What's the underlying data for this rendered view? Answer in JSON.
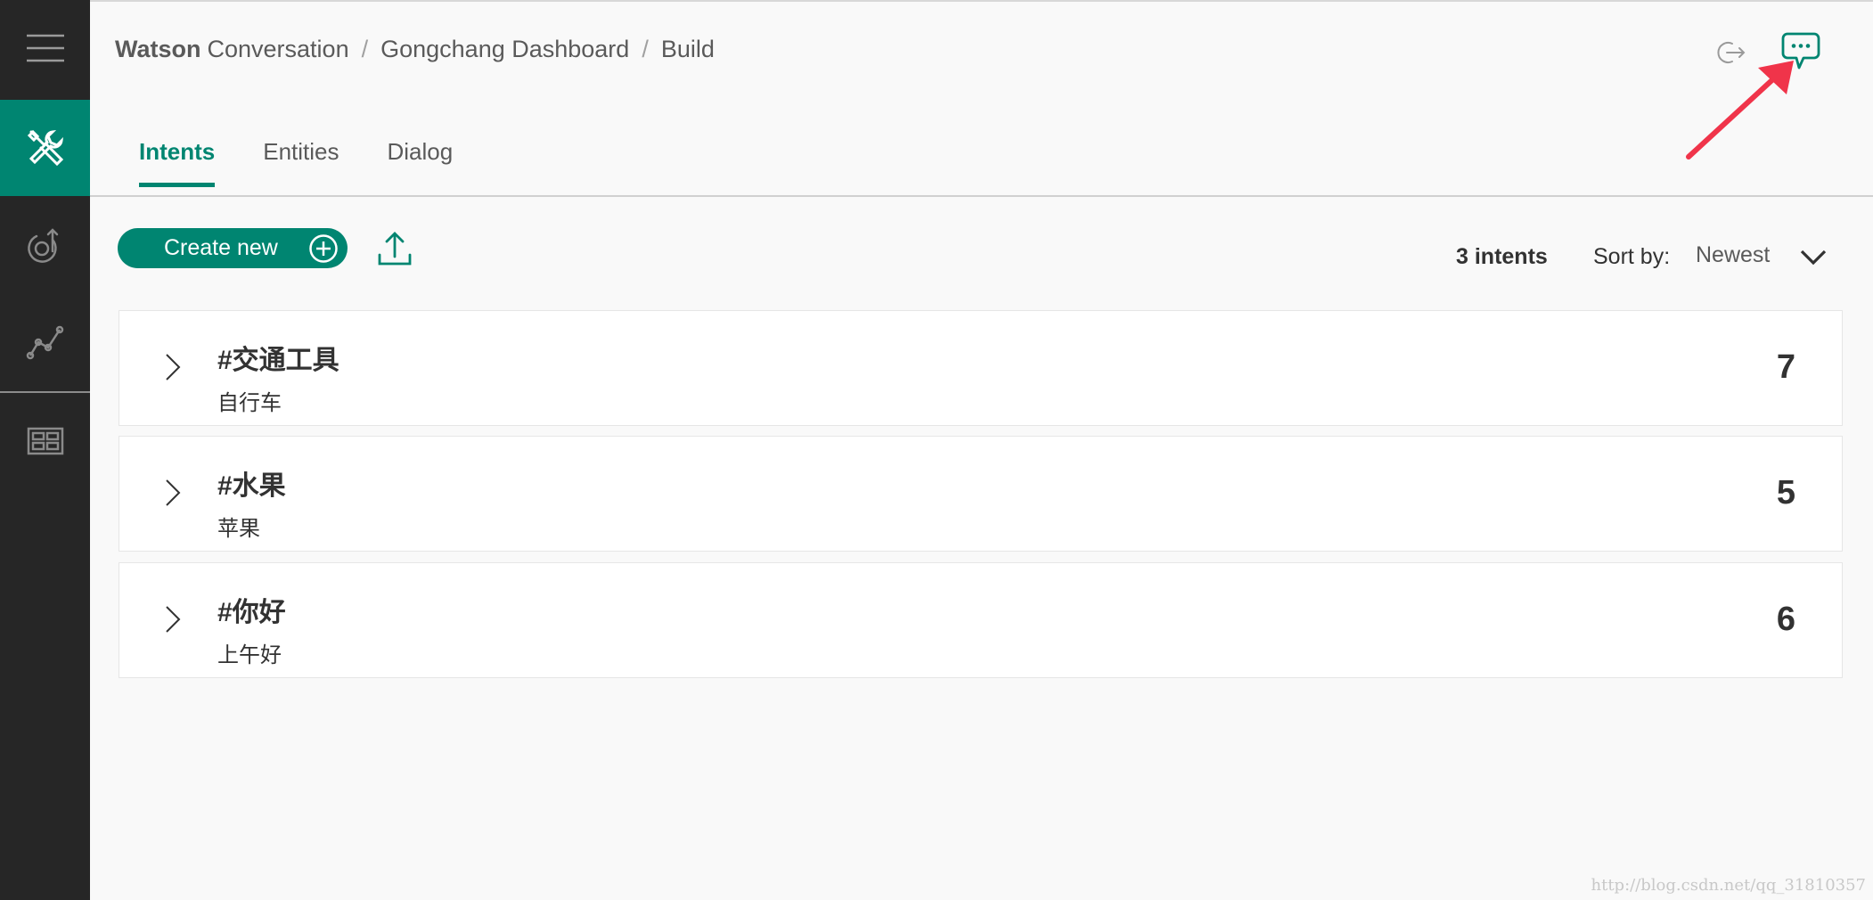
{
  "breadcrumb": {
    "brand": "Watson",
    "product": "Conversation",
    "separator": "/",
    "workspace": "Gongchang Dashboard",
    "page": "Build"
  },
  "sidebar": {
    "items": [
      {
        "icon": "menu-icon"
      },
      {
        "icon": "tools-icon",
        "active": true
      },
      {
        "icon": "deploy-icon"
      },
      {
        "icon": "analytics-icon"
      },
      {
        "icon": "dashboard-icon"
      }
    ]
  },
  "header_icons": [
    "logout-icon",
    "chat-icon"
  ],
  "tabs": [
    {
      "label": "Intents",
      "active": true
    },
    {
      "label": "Entities",
      "active": false
    },
    {
      "label": "Dialog",
      "active": false
    }
  ],
  "toolbar": {
    "create_label": "Create new",
    "count_label": "3 intents",
    "sort_label": "Sort by:",
    "sort_value": "Newest"
  },
  "intents": [
    {
      "name": "#交通工具",
      "example": "自行车",
      "count": "7"
    },
    {
      "name": "#水果",
      "example": "苹果",
      "count": "5"
    },
    {
      "name": "#你好",
      "example": "上午好",
      "count": "6"
    }
  ],
  "watermark": "http://blog.csdn.net/qq_31810357",
  "colors": {
    "accent": "#008571",
    "sidebar": "#262626",
    "annotation": "#f0344a"
  }
}
